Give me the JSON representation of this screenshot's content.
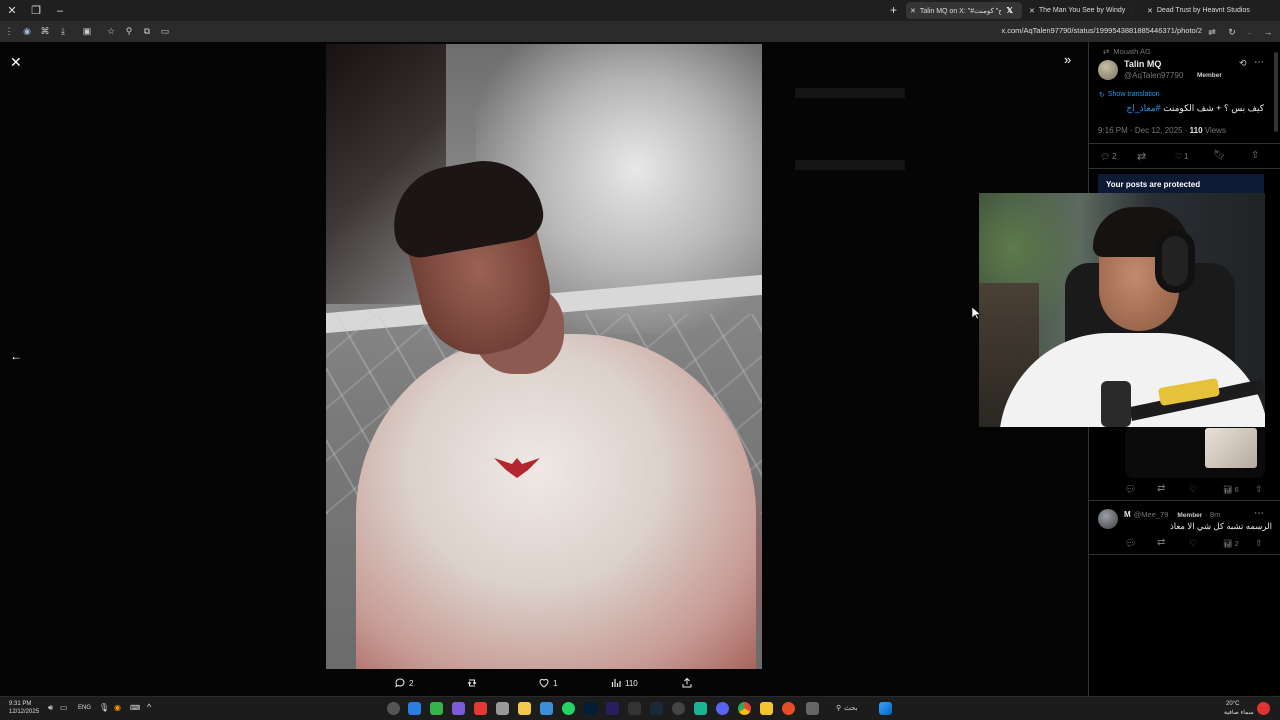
{
  "browser": {
    "tabs": [
      {
        "title": "Talin MQ on X: \"#معاذ_اج\" كومنت",
        "icon": "x-logo-icon",
        "active": true
      },
      {
        "title": "The Man You See by Windy",
        "icon": "music-icon",
        "active": false
      },
      {
        "title": "Dead Trust by Heavnt Studios",
        "icon": "game-icon",
        "active": false
      }
    ],
    "url": "x.com/AqTalen97790/status/1999543881885446371/photo/2"
  },
  "viewer": {
    "close_icon": "close-icon",
    "prev_icon": "arrow-left-icon",
    "expand_icon": "chevrons-right-icon",
    "actions": {
      "replies": "2",
      "likes": "1",
      "views": "110"
    }
  },
  "post": {
    "repost_context": "Mouath AG",
    "author_name": "Talin MQ",
    "author_handle": "@AqTalen97790",
    "author_badge": "Member",
    "show_translation": "Show translation",
    "text_plain": "كيف بس ؟ + شف الكومنت ",
    "text_hashtag": "#معاذ_اج",
    "time": "9:16 PM · Dec 12, 2025 · ",
    "views_count": "110",
    "views_label": "Views",
    "replies": "2",
    "likes": "1",
    "protected_notice": "Your posts are protected"
  },
  "reply_thread": {
    "views": "6"
  },
  "reply": {
    "name": "M",
    "handle": "@Mee_79",
    "badge": "Member",
    "age": "· 8m",
    "text": "الرسمه تشبه كل شي الا معاذ",
    "views": "2"
  },
  "taskbar": {
    "time": "9:31 PM",
    "date": "12/12/2025",
    "lang": "ENG",
    "search": "بحث",
    "weather_temp": "20°C",
    "weather_desc": "سماء صافية"
  }
}
